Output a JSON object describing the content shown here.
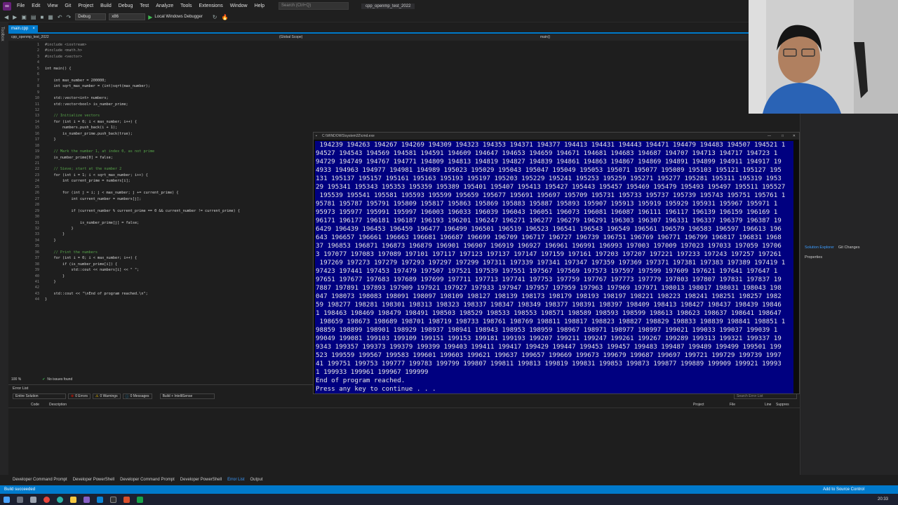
{
  "menu": [
    "File",
    "Edit",
    "View",
    "Git",
    "Project",
    "Build",
    "Debug",
    "Test",
    "Analyze",
    "Tools",
    "Extensions",
    "Window",
    "Help"
  ],
  "search_placeholder": "Search (Ctrl+Q)",
  "solution_name": "cpp_openmp_test_2022",
  "toolbar": {
    "config": "Debug",
    "platform": "x86",
    "run_label": "Local Windows Debugger"
  },
  "tab_label": "main.cpp",
  "nav": {
    "project": "cpp_openmp_test_2022",
    "scope": "(Global Scope)",
    "func": "main()"
  },
  "toolbox_label": "Toolbox",
  "code": [
    {
      "n": "1",
      "t": "#include <iostream>"
    },
    {
      "n": "2",
      "t": "#include <math.h>"
    },
    {
      "n": "3",
      "t": "#include <vector>"
    },
    {
      "n": "4",
      "t": ""
    },
    {
      "n": "5",
      "t": "int main() {"
    },
    {
      "n": "6",
      "t": ""
    },
    {
      "n": "7",
      "t": "    int max_number = 200000;"
    },
    {
      "n": "8",
      "t": "    int sqrt_max_number = (int)sqrt(max_number);"
    },
    {
      "n": "9",
      "t": ""
    },
    {
      "n": "10",
      "t": "    std::vector<int> numbers;"
    },
    {
      "n": "11",
      "t": "    std::vector<bool> is_number_prime;"
    },
    {
      "n": "12",
      "t": ""
    },
    {
      "n": "13",
      "t": "    // Initialize vectors"
    },
    {
      "n": "14",
      "t": "    for (int i = 0; i < max_number; i++) {"
    },
    {
      "n": "15",
      "t": "        numbers.push_back(i + 1);"
    },
    {
      "n": "16",
      "t": "        is_number_prime.push_back(true);"
    },
    {
      "n": "17",
      "t": "    }"
    },
    {
      "n": "18",
      "t": ""
    },
    {
      "n": "19",
      "t": "    // Mark the number 1, at index 0, as not prime"
    },
    {
      "n": "20",
      "t": "    is_number_prime[0] = false;"
    },
    {
      "n": "21",
      "t": ""
    },
    {
      "n": "22",
      "t": "    // Sieve; start at the number 2"
    },
    {
      "n": "23",
      "t": "    for (int i = 1; i < sqrt_max_number; i++) {"
    },
    {
      "n": "24",
      "t": "        int current_prime = numbers[i];"
    },
    {
      "n": "25",
      "t": ""
    },
    {
      "n": "26",
      "t": "        for (int j = i; j < max_number; j += current_prime) {"
    },
    {
      "n": "27",
      "t": "            int current_number = numbers[j];"
    },
    {
      "n": "28",
      "t": ""
    },
    {
      "n": "29",
      "t": "            if (current_number % current_prime == 0 && current_number != current_prime) {"
    },
    {
      "n": "30",
      "t": ""
    },
    {
      "n": "31",
      "t": "                is_number_prime[j] = false;"
    },
    {
      "n": "32",
      "t": "            }"
    },
    {
      "n": "33",
      "t": "        }"
    },
    {
      "n": "34",
      "t": "    }"
    },
    {
      "n": "35",
      "t": ""
    },
    {
      "n": "36",
      "t": "    // Print the numbers"
    },
    {
      "n": "37",
      "t": "    for (int i = 0; i < max_number; i++) {"
    },
    {
      "n": "38",
      "t": "        if (is_number_prime[i]) {"
    },
    {
      "n": "39",
      "t": "            std::cout << numbers[i] << \" \";"
    },
    {
      "n": "40",
      "t": "        }"
    },
    {
      "n": "41",
      "t": "    }"
    },
    {
      "n": "42",
      "t": ""
    },
    {
      "n": "43",
      "t": "    std::cout << \"\\nEnd of program reached.\\n\";"
    },
    {
      "n": "44",
      "t": "}"
    }
  ],
  "editor_status": {
    "zoom": "100 %",
    "issues": "No issues found"
  },
  "error_list": {
    "title": "Error List",
    "scope": "Entire Solution",
    "errors": "0 Errors",
    "warnings": "0 Warnings",
    "messages": "0 Messages",
    "build": "Build + IntelliSense",
    "search": "Search Error List",
    "columns": [
      "Code",
      "Description",
      "Project",
      "File",
      "Line",
      "Suppres"
    ]
  },
  "console": {
    "title": "C:\\WINDOWS\\system32\\cmd.exe",
    "lines": [
      " 194239 194263 194267 194269 194309 194323 194353 194371 194377 194413 194431 194443 194471 194479 194483 194507 194521 1",
      "94527 194543 194569 194581 194591 194609 194647 194653 194659 194671 194681 194683 194687 194707 194713 194717 194723 1",
      "94729 194749 194767 194771 194809 194813 194819 194827 194839 194861 194863 194867 194869 194891 194899 194911 194917 19",
      "4933 194963 194977 194981 194989 195023 195029 195043 195047 195049 195053 195071 195077 195089 195103 195121 195127 195",
      "131 195137 195157 195161 195163 195193 195197 195203 195229 195241 195253 195259 195271 195277 195281 195311 195319 1953",
      "29 195341 195343 195353 195359 195389 195401 195407 195413 195427 195443 195457 195469 195479 195493 195497 195511 195527",
      " 195539 195541 195581 195593 195599 195659 195677 195691 195697 195709 195731 195733 195737 195739 195743 195751 195761 1",
      "95781 195787 195791 195809 195817 195863 195869 195883 195887 195893 195907 195913 195919 195929 195931 195967 195971 1",
      "95973 195977 195991 195997 196003 196033 196039 196043 196051 196073 196081 196087 196111 196117 196139 196159 196169 1",
      "96171 196177 196181 196187 196193 196201 196247 196271 196277 196279 196291 196303 196307 196331 196337 196379 196387 19",
      "6429 196439 196453 196459 196477 196499 196501 196519 196523 196541 196543 196549 196561 196579 196583 196597 196613 196",
      "643 196657 196661 196663 196681 196687 196699 196709 196717 196727 196739 196751 196769 196771 196799 196817 196831 1968",
      "37 196853 196871 196873 196879 196901 196907 196919 196927 196961 196991 196993 197003 197009 197023 197033 197059 19706",
      "3 197077 197083 197089 197101 197117 197123 197137 197147 197159 197161 197203 197207 197221 197233 197243 197257 197261",
      " 197269 197273 197279 197293 197297 197299 197311 197339 197341 197347 197359 197369 197371 197381 197383 197389 197419 1",
      "97423 197441 197453 197479 197507 197521 197539 197551 197567 197569 197573 197597 197599 197609 197621 197641 197647 1",
      "97651 197677 197683 197689 197699 197711 197713 197741 197753 197759 197767 197773 197779 197803 197807 197831 197837 19",
      "7887 197891 197893 197909 197921 197927 197933 197947 197957 197959 197963 197969 197971 198013 198017 198031 198043 198",
      "047 198073 198083 198091 198097 198109 198127 198139 198173 198179 198193 198197 198221 198223 198241 198251 198257 1982",
      "59 198277 198281 198301 198313 198323 198337 198347 198349 198377 198391 198397 198409 198413 198427 198437 198439 19846",
      "1 198463 198469 198479 198491 198503 198529 198533 198553 198571 198589 198593 198599 198613 198623 198637 198641 198647",
      " 198659 198673 198689 198701 198719 198733 198761 198769 198811 198817 198823 198827 198829 198833 198839 198841 198851 1",
      "98859 198899 198901 198929 198937 198941 198943 198953 198959 198967 198971 198977 198997 199021 199033 199037 199039 1",
      "99049 199081 199103 199109 199151 199153 199181 199193 199207 199211 199247 199261 199267 199289 199313 199321 199337 19",
      "9343 199357 199373 199379 199399 199403 199411 199417 199429 199447 199453 199457 199483 199487 199489 199499 199501 199",
      "523 199559 199567 199583 199601 199603 199621 199637 199657 199669 199673 199679 199687 199697 199721 199729 199739 1997",
      "41 199751 199753 199777 199783 199799 199807 199811 199813 199819 199831 199853 199873 199877 199889 199909 199921 19993",
      "1 199933 199961 199967 199999",
      "End of program reached.",
      "Press any key to continue . . ."
    ]
  },
  "right_panel": {
    "tabs": [
      "Solution Explorer",
      "Git Changes"
    ],
    "properties": "Properties"
  },
  "bottom_tabs": [
    "Developer Command Prompt",
    "Developer PowerShell",
    "Developer Command Prompt",
    "Developer PowerShell",
    "Error List",
    "Output"
  ],
  "status": {
    "left": "Build succeeded",
    "right": "Add to Source Control"
  },
  "clock": "20:33"
}
